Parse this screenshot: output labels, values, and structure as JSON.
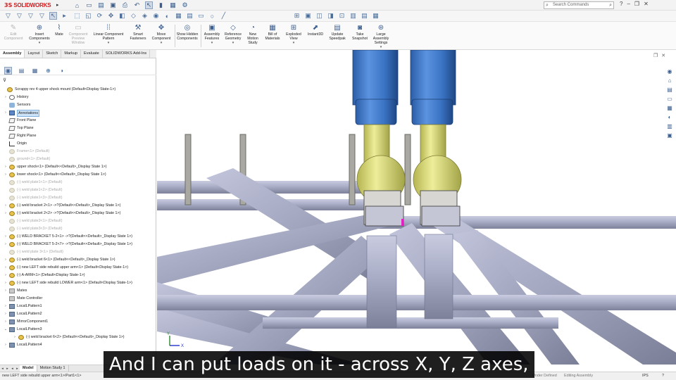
{
  "app": {
    "logo_ds": "3S",
    "logo_name": "SOLIDWORKS"
  },
  "search": {
    "placeholder": "Search Commands"
  },
  "command_manager": [
    {
      "label": "Edit Component",
      "disabled": true
    },
    {
      "label": "Insert Components",
      "disabled": false
    },
    {
      "label": "Mate",
      "disabled": false
    },
    {
      "label": "Component Preview Window",
      "disabled": true
    },
    {
      "label": "Linear Component Pattern",
      "disabled": false
    },
    {
      "label": "Smart Fasteners",
      "disabled": false
    },
    {
      "label": "Move Component",
      "disabled": false
    },
    {
      "label": "Show Hidden Components",
      "disabled": false
    },
    {
      "label": "Assembly Features",
      "disabled": false
    },
    {
      "label": "Reference Geometry",
      "disabled": false
    },
    {
      "label": "New Motion Study",
      "disabled": false
    },
    {
      "label": "Bill of Materials",
      "disabled": false
    },
    {
      "label": "Exploded View",
      "disabled": false
    },
    {
      "label": "Instant3D",
      "disabled": false
    },
    {
      "label": "Update Speedpak",
      "disabled": false
    },
    {
      "label": "Take Snapshot",
      "disabled": false
    },
    {
      "label": "Large Assembly Settings",
      "disabled": false
    }
  ],
  "tabs": [
    "Assembly",
    "Layout",
    "Sketch",
    "Markup",
    "Evaluate",
    "SOLIDWORKS Add-Ins"
  ],
  "active_tab": "Assembly",
  "tree": [
    {
      "label": "Scrappy rev 4 upper shock mount  (Default<Display State-1>)",
      "icon": "asm",
      "level": 0,
      "expander": "",
      "suppressed": false
    },
    {
      "label": "History",
      "icon": "hist",
      "level": 1,
      "expander": "›",
      "suppressed": false
    },
    {
      "label": "Sensors",
      "icon": "sens",
      "level": 1,
      "expander": "",
      "suppressed": false
    },
    {
      "label": "Annotations",
      "icon": "ann",
      "level": 1,
      "expander": "›",
      "suppressed": false,
      "highlight": true
    },
    {
      "label": "Front Plane",
      "icon": "plane",
      "level": 1,
      "expander": "",
      "suppressed": false
    },
    {
      "label": "Top Plane",
      "icon": "plane",
      "level": 1,
      "expander": "",
      "suppressed": false
    },
    {
      "label": "Right Plane",
      "icon": "plane",
      "level": 1,
      "expander": "",
      "suppressed": false
    },
    {
      "label": "Origin",
      "icon": "origin",
      "level": 1,
      "expander": "",
      "suppressed": false
    },
    {
      "label": "Frame<1> (Default)",
      "icon": "asm",
      "level": 1,
      "expander": "",
      "suppressed": true
    },
    {
      "label": "ground<1> (Default)",
      "icon": "asm",
      "level": 1,
      "expander": "",
      "suppressed": true
    },
    {
      "label": "upper shock<1> (Default<<Default>_Display State 1>)",
      "icon": "asm",
      "level": 1,
      "expander": "›",
      "suppressed": false
    },
    {
      "label": "lower shock<1> (Default<<Default>_Display State 1>)",
      "icon": "asm",
      "level": 1,
      "expander": "›",
      "suppressed": false
    },
    {
      "label": "(-) weld plate1<1> (Default)",
      "icon": "asm",
      "level": 1,
      "expander": "",
      "suppressed": true
    },
    {
      "label": "(-) weld plate1<2> (Default)",
      "icon": "asm",
      "level": 1,
      "expander": "",
      "suppressed": true
    },
    {
      "label": "(-) weld plate1<3> (Default)",
      "icon": "asm",
      "level": 1,
      "expander": "",
      "suppressed": true
    },
    {
      "label": "(-) weld bracket 2<1> ->?(Default<<Default>_Display State 1>)",
      "icon": "asm",
      "level": 1,
      "expander": "›",
      "suppressed": false
    },
    {
      "label": "(-) weld bracket 2<2> ->?(Default<<Default>_Display State 1>)",
      "icon": "asm",
      "level": 1,
      "expander": "›",
      "suppressed": false
    },
    {
      "label": "(-) weld plate3<1> (Default)",
      "icon": "asm",
      "level": 1,
      "expander": "",
      "suppressed": true
    },
    {
      "label": "(-) weld plate3<3> (Default)",
      "icon": "asm",
      "level": 1,
      "expander": "",
      "suppressed": true
    },
    {
      "label": "(-) WELD BRACKET 5-2<1> ->?(Default<<Default>_Display State 1>)",
      "icon": "asm",
      "level": 1,
      "expander": "›",
      "suppressed": false
    },
    {
      "label": "(-) WELD BRACKET 5-2<7> ->?(Default<<Default>_Display State 1>)",
      "icon": "asm",
      "level": 1,
      "expander": "›",
      "suppressed": false
    },
    {
      "label": "(-) weld plate 3<1> (Default)",
      "icon": "asm",
      "level": 1,
      "expander": "",
      "suppressed": true
    },
    {
      "label": "(-) weld bracket 6<1> (Default<<Default>_Display State 1>)",
      "icon": "asm",
      "level": 1,
      "expander": "›",
      "suppressed": false
    },
    {
      "label": "(-) new LEFT side rebuild upper arm<1> (Default<Display State-1>)",
      "icon": "asm",
      "level": 1,
      "expander": "›",
      "suppressed": false
    },
    {
      "label": "(-) A-ARM<1> (Default<Display State-1>)",
      "icon": "asm",
      "level": 1,
      "expander": "›",
      "suppressed": false
    },
    {
      "label": "(-) new LEFT side rebuild LOWER arm<1> (Default<Display State-1>)",
      "icon": "asm",
      "level": 1,
      "expander": "›",
      "suppressed": false
    },
    {
      "label": "Mates",
      "icon": "folder",
      "level": 1,
      "expander": "›",
      "suppressed": false
    },
    {
      "label": "Mate Controller",
      "icon": "folder",
      "level": 1,
      "expander": "",
      "suppressed": false
    },
    {
      "label": "LocalLPattern1",
      "icon": "pat",
      "level": 1,
      "expander": "›",
      "suppressed": false
    },
    {
      "label": "LocalLPattern2",
      "icon": "pat",
      "level": 1,
      "expander": "›",
      "suppressed": false
    },
    {
      "label": "MirrorComponent1",
      "icon": "pat",
      "level": 1,
      "expander": "›",
      "suppressed": false
    },
    {
      "label": "LocalLPattern3",
      "icon": "pat",
      "level": 1,
      "expander": "⌄",
      "suppressed": false
    },
    {
      "label": "(-) weld bracket 6<2> (Default<<Default>_Display State 1>)",
      "icon": "asm",
      "level": 2,
      "expander": "›",
      "suppressed": false
    },
    {
      "label": "LocalLPattern4",
      "icon": "pat",
      "level": 1,
      "expander": "›",
      "suppressed": false
    }
  ],
  "bottom_tabs": [
    "Model",
    "Motion Study 1"
  ],
  "active_bottom_tab": "Model",
  "status": {
    "left": "new LEFT side rebuild upper arm<1>/Part1<1>",
    "right1": "Under Defined",
    "right2": "Editing Assembly",
    "units": "IPS"
  },
  "caption": "And I can put loads on it - across X, Y, Z axes,",
  "triad": {
    "y": "Y",
    "x": "X"
  },
  "colors": {
    "shock_blue": "#3f78c8",
    "shock_yellow": "#dede78",
    "tube_gray": "#a7abc4",
    "accent_red": "#d7191c"
  }
}
